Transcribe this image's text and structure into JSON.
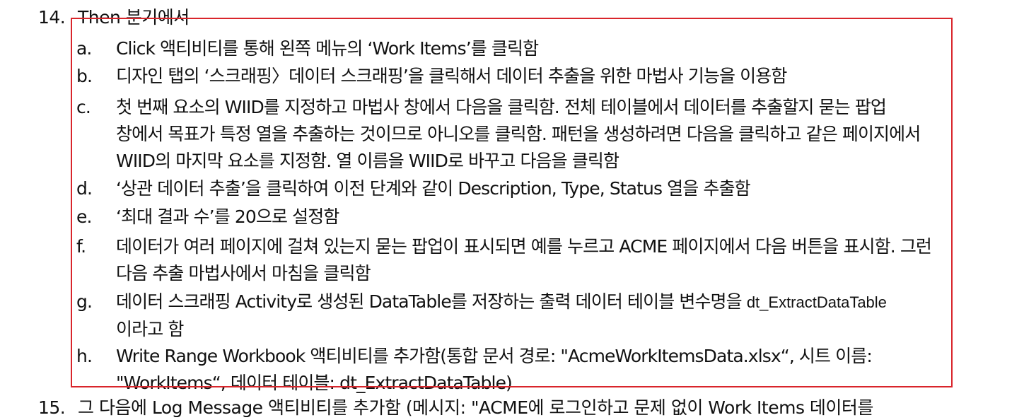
{
  "step": {
    "number": "14.",
    "title": "Then 분기에서"
  },
  "items": [
    {
      "marker": "a.",
      "lines": [
        "Click 액티비티를 통해 왼쪽 메뉴의 ‘Work Items’를 클릭함"
      ]
    },
    {
      "marker": "b.",
      "lines": [
        "디자인 탭의 ‘스크래핑〉데이터 스크래핑’을 클릭해서 데이터 추출을 위한 마법사 기능을 이용함"
      ]
    },
    {
      "marker": "c.",
      "lines": [
        "첫 번째 요소의 WIID를 지정하고 마법사 창에서 다음을 클릭함. 전체 테이블에서 데이터를 추출할지 묻는 팝업",
        "창에서 목표가 특정 열을 추출하는 것이므로 아니오를 클릭함. 패턴을 생성하려면 다음을 클릭하고 같은 페이지에서",
        "WIID의 마지막 요소를 지정함. 열 이름을 WIID로 바꾸고 다음을 클릭함"
      ]
    },
    {
      "marker": "d.",
      "lines": [
        "‘상관 데이터 추출’을 클릭하여 이전 단계와 같이 Description, Type, Status 열을 추출함"
      ]
    },
    {
      "marker": "e.",
      "lines": [
        "‘최대 결과 수’를 20으로 설정함"
      ]
    },
    {
      "marker": "f.",
      "lines": [
        "데이터가 여러 페이지에 걸쳐 있는지 묻는 팝업이 표시되면 예를 누르고 ACME 페이지에서 다음 버튼을 표시함. 그런",
        "다음 추출 마법사에서 마침을 클릭함"
      ]
    },
    {
      "marker": "g.",
      "lines": [
        "데이터 스크래핑 Activity로 생성된 DataTable를 저장하는 출력 데이터 테이블 변수명을",
        "이라고 함"
      ],
      "tail": "dt_ExtractDataTable"
    },
    {
      "marker": "h.",
      "lines": [
        "Write Range Workbook 액티비티를 추가함(통합 문서 경로: \"AcmeWorkItemsData.xlsx“, 시트 이름:",
        "\"WorkItems“, 데이터 테이블: dt_ExtractDataTable)"
      ]
    }
  ],
  "next_step": {
    "number": "15.",
    "title": "그 다음에 Log Message 액티비티를 추가함 (메시지: \"ACME에 로그인하고 문제 없이 Work Items 데이터를"
  },
  "colors": {
    "highlight_border": "#d9252b",
    "text": "#111111",
    "background": "#ffffff"
  }
}
